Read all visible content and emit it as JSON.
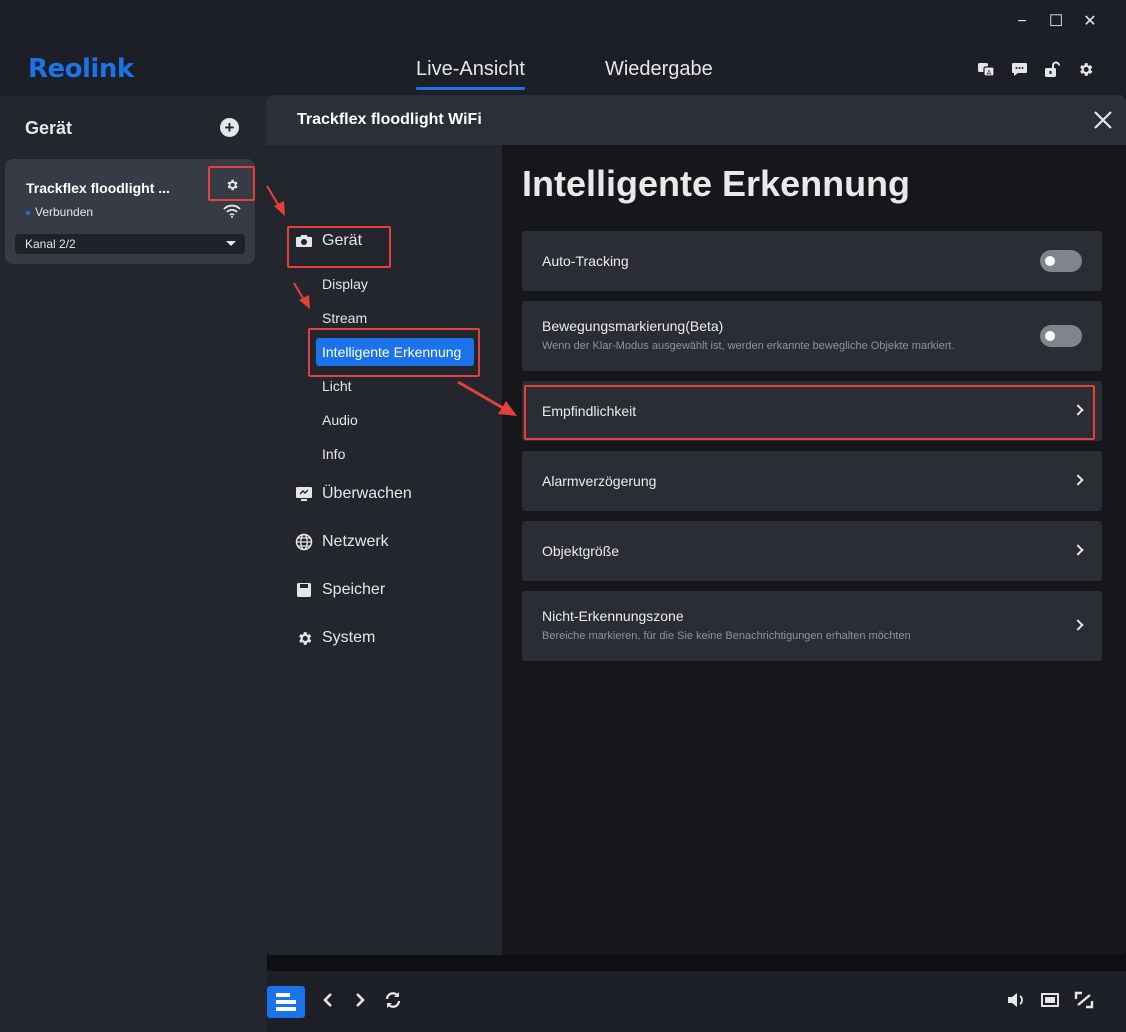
{
  "window": {
    "minimize": "−",
    "maximize": "☐",
    "close": "✕"
  },
  "brand": {
    "logo": "Reolink",
    "accent": "#1a73e8"
  },
  "top_nav": {
    "tabs": [
      {
        "label": "Live-Ansicht",
        "active": true
      },
      {
        "label": "Wiedergabe",
        "active": false
      }
    ],
    "icons": [
      "translate-icon",
      "message-icon",
      "unlock-icon",
      "gear-icon"
    ]
  },
  "sidebar": {
    "title": "Gerät",
    "device": {
      "name": "Trackflex floodlight ...",
      "status": "Verbunden",
      "channel": "Kanal 2/2"
    }
  },
  "dialog": {
    "title": "Trackflex floodlight WiFi",
    "nav": {
      "groups": [
        {
          "label": "Gerät",
          "icon": "camera-icon"
        },
        {
          "label": "Überwachen",
          "icon": "monitor-icon"
        },
        {
          "label": "Netzwerk",
          "icon": "globe-icon"
        },
        {
          "label": "Speicher",
          "icon": "save-icon"
        },
        {
          "label": "System",
          "icon": "gear-icon"
        }
      ],
      "sub_items": [
        {
          "label": "Display"
        },
        {
          "label": "Stream"
        },
        {
          "label": "Intelligente Erkennung",
          "active": true
        },
        {
          "label": "Licht"
        },
        {
          "label": "Audio"
        },
        {
          "label": "Info"
        }
      ]
    },
    "content": {
      "title": "Intelligente Erkennung",
      "rows": [
        {
          "label": "Auto-Tracking",
          "control": "toggle",
          "on": false
        },
        {
          "label": "Bewegungsmarkierung(Beta)",
          "description": "Wenn der Klar-Modus ausgewählt ist, werden erkannte bewegliche Objekte markiert.",
          "control": "toggle",
          "on": false
        },
        {
          "label": "Empfindlichkeit",
          "control": "chevron"
        },
        {
          "label": "Alarmverzögerung",
          "control": "chevron"
        },
        {
          "label": "Objektgröße",
          "control": "chevron"
        },
        {
          "label": "Nicht-Erkennungszone",
          "description": "Bereiche markieren, für die Sie keine Benachrichtigungen erhalten möchten",
          "control": "chevron"
        }
      ]
    }
  },
  "bottom_bar": {
    "left_icons": [
      "layout-icon",
      "previous-icon",
      "next-icon",
      "refresh-icon"
    ],
    "right_icons": [
      "volume-icon",
      "aspect-ratio-icon",
      "fullscreen-icon"
    ]
  },
  "annotation_color": "#e5403a"
}
